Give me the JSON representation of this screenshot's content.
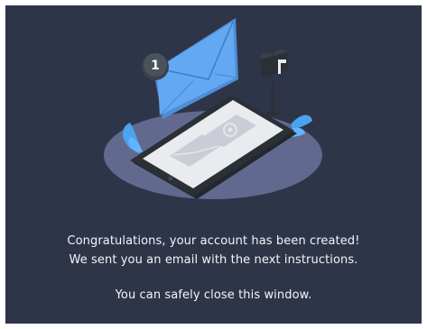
{
  "illustration": {
    "notification_count": "1",
    "colors": {
      "background": "#2f3549",
      "ellipse": "#61698f",
      "envelope": "#63a8f2",
      "envelope_dark": "#4f8ed6",
      "phone_body": "#2b3037",
      "phone_screen": "#e9ebef",
      "accent_leaves": "#4aa3f0"
    },
    "icons": [
      "envelope-icon",
      "phone-icon",
      "mailbox-icon",
      "notification-badge-icon"
    ]
  },
  "messages": {
    "line1": "Congratulations, your account has been created!",
    "line2": "We sent you an email with the next instructions.",
    "line3": "You can safely close this window."
  }
}
